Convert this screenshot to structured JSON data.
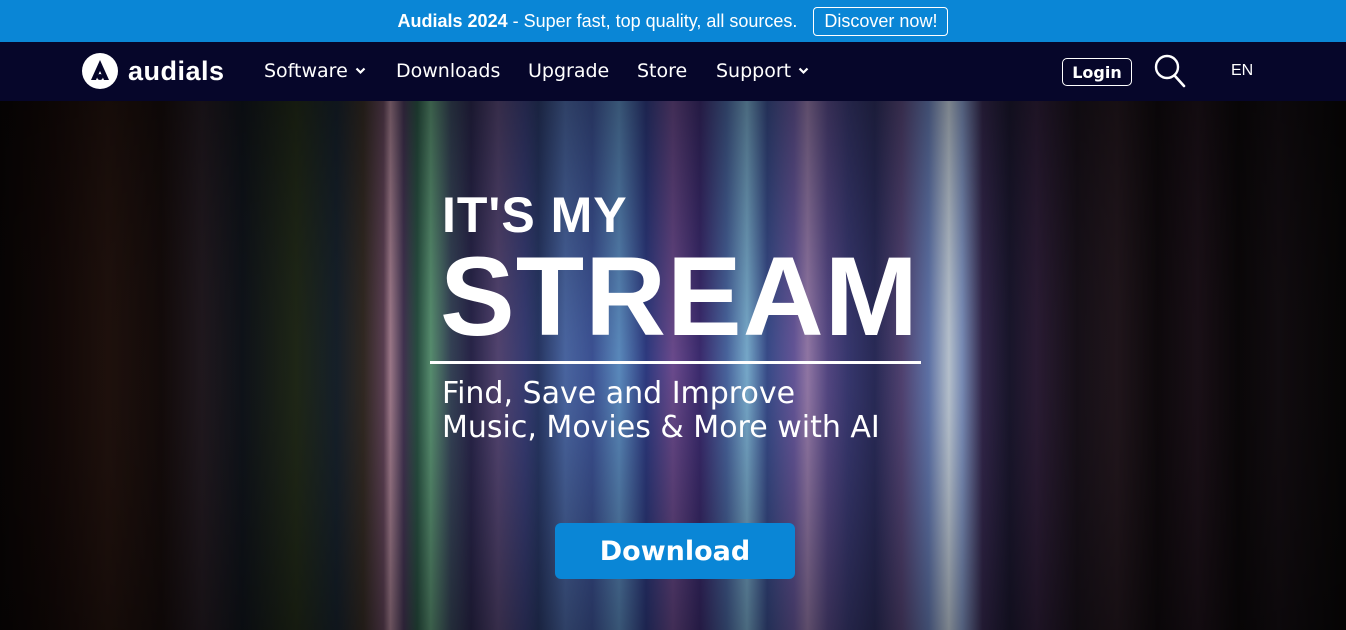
{
  "promo": {
    "brand": "Audials 2024",
    "separator": " - ",
    "text": "Super fast, top quality, all sources.",
    "cta": "Discover now!"
  },
  "nav": {
    "logo_text": "audials",
    "items": [
      {
        "label": "Software",
        "dropdown": true
      },
      {
        "label": "Downloads",
        "dropdown": false
      },
      {
        "label": "Upgrade",
        "dropdown": false
      },
      {
        "label": "Store",
        "dropdown": false
      },
      {
        "label": "Support",
        "dropdown": true
      }
    ],
    "login": "Login",
    "search_icon": "search-icon",
    "language": "EN"
  },
  "hero": {
    "line1": "IT'S MY",
    "line2": "STREAM",
    "subtitle_line1": "Find, Save and Improve",
    "subtitle_line2": "Music, Movies & More with AI",
    "download": "Download"
  },
  "colors": {
    "accent": "#0a86d6",
    "navbar": "#06062a",
    "text": "#ffffff"
  }
}
